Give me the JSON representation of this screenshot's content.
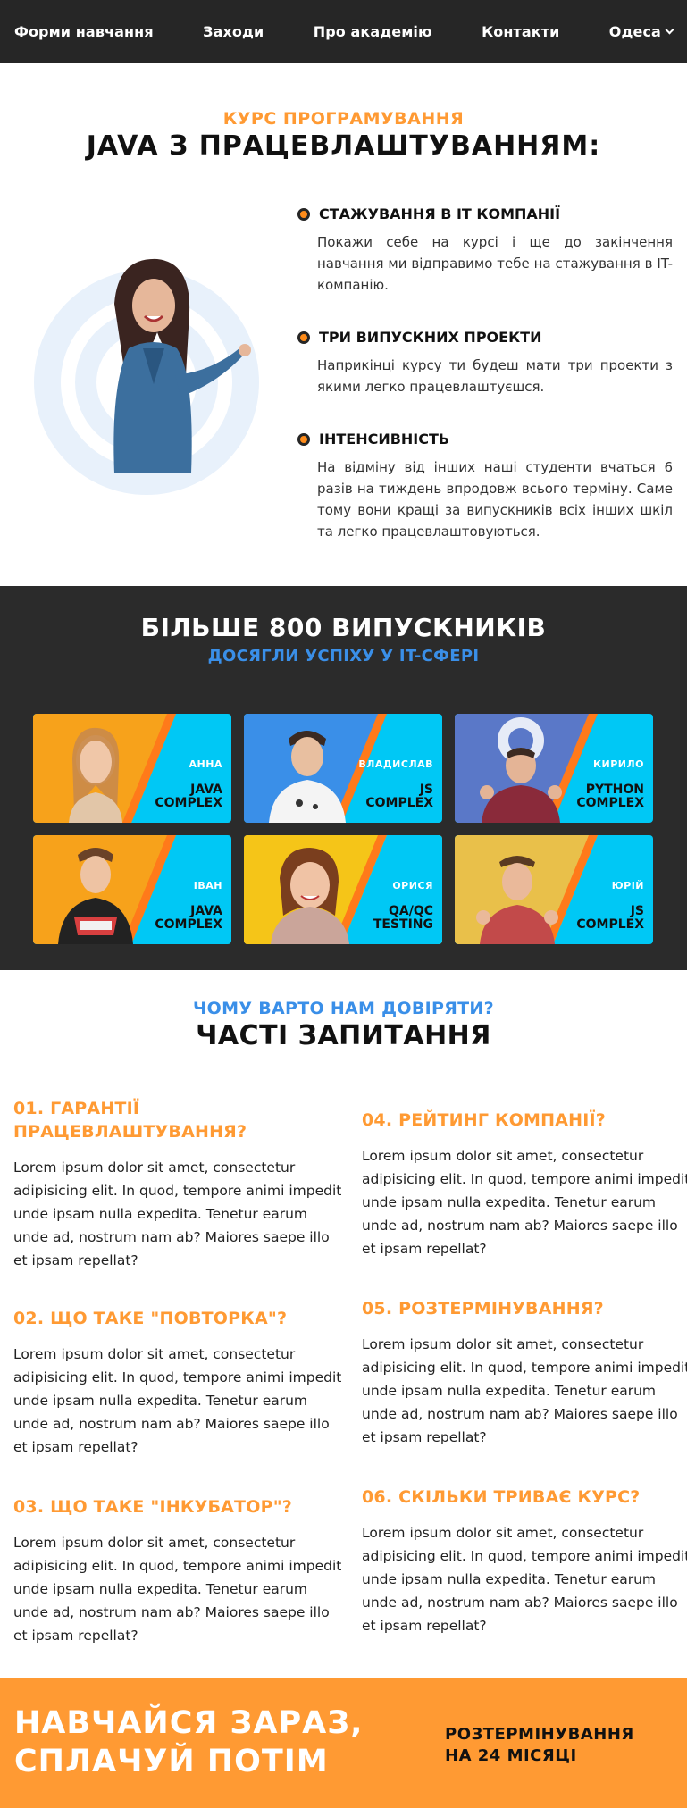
{
  "nav": {
    "items": [
      "Форми навчання",
      "Заходи",
      "Про академію",
      "Контакти"
    ],
    "city": "Одеса"
  },
  "hero": {
    "subtitle": "КУРС ПРОГРАМУВАННЯ",
    "title": "JAVA З ПРАЦЕВЛАШТУВАННЯМ:",
    "features": [
      {
        "title": "СТАЖУВАННЯ В IT КОМПАНІЇ",
        "text": "Покажи себе на курсі і ще до закінчення навчання ми відправимо тебе на стажування в IT-компанію."
      },
      {
        "title": "ТРИ ВИПУСКНИХ ПРОЕКТИ",
        "text": "Наприкінці курсу ти будеш мати три проекти з якими легко працевлаштуєшся."
      },
      {
        "title": "ІНТЕНСИВНІСТЬ",
        "text": "На відміну від інших наші студенти вчаться 6 разів на тиждень впродовж всього терміну. Саме тому вони кращі за випускників всіх інших шкіл та легко працевлаштовуються."
      }
    ]
  },
  "graduates": {
    "title": "БІЛЬШЕ 800 ВИПУСКНИКІВ",
    "subtitle": "ДОСЯГЛИ УСПІХУ У IT-СФЕРІ",
    "cards": [
      {
        "name": "АННА",
        "course_line1": "JAVA",
        "course_line2": "COMPLEX"
      },
      {
        "name": "ВЛАДИСЛАВ",
        "course_line1": "JS",
        "course_line2": "COMPLEX"
      },
      {
        "name": "КИРИЛО",
        "course_line1": "PYTHON",
        "course_line2": "COMPLEX"
      },
      {
        "name": "ІВАН",
        "course_line1": "JAVA",
        "course_line2": "COMPLEX"
      },
      {
        "name": "ОРИСЯ",
        "course_line1": "QA/QC",
        "course_line2": "TESTING"
      },
      {
        "name": "ЮРІЙ",
        "course_line1": "JS",
        "course_line2": "COMPLEX"
      }
    ]
  },
  "faq": {
    "subtitle": "ЧОМУ ВАРТО НАМ ДОВІРЯТИ?",
    "title": "ЧАСТІ ЗАПИТАННЯ",
    "items": [
      {
        "q": "01. ГАРАНТІЇ ПРАЦЕВЛАШТУВАННЯ?",
        "a": "Lorem ipsum dolor sit amet, consectetur adipisicing elit. In quod, tempore animi impedit unde ipsam nulla expedita. Tenetur earum unde ad, nostrum nam ab? Maiores saepe illo et ipsam repellat?"
      },
      {
        "q": "02. ЩО ТАКЕ \"ПОВТОРКА\"?",
        "a": "Lorem ipsum dolor sit amet, consectetur adipisicing elit. In quod, tempore animi impedit unde ipsam nulla expedita. Tenetur earum unde ad, nostrum nam ab? Maiores saepe illo et ipsam repellat?"
      },
      {
        "q": "03. ЩО ТАКЕ \"ІНКУБАТОР\"?",
        "a": "Lorem ipsum dolor sit amet, consectetur adipisicing elit. In quod, tempore animi impedit unde ipsam nulla expedita. Tenetur earum unde ad, nostrum nam ab? Maiores saepe illo et ipsam repellat?"
      },
      {
        "q": "04. РЕЙТИНГ КОМПАНІЇ?",
        "a": "Lorem ipsum dolor sit amet, consectetur adipisicing elit. In quod, tempore animi impedit unde ipsam nulla expedita. Tenetur earum unde ad, nostrum nam ab? Maiores saepe illo et ipsam repellat?"
      },
      {
        "q": "05. РОЗТЕРМІНУВАННЯ?",
        "a": "Lorem ipsum dolor sit amet, consectetur adipisicing elit. In quod, tempore animi impedit unde ipsam nulla expedita. Tenetur earum unde ad, nostrum nam ab? Maiores saepe illo et ipsam repellat?"
      },
      {
        "q": "06. СКІЛЬКИ ТРИВАЄ КУРС?",
        "a": "Lorem ipsum dolor sit amet, consectetur adipisicing elit. In quod, tempore animi impedit unde ipsam nulla expedita. Tenetur earum unde ad, nostrum nam ab? Maiores saepe illo et ipsam repellat?"
      }
    ]
  },
  "cta": {
    "left_line1": "НАВЧАЙСЯ ЗАРАЗ,",
    "left_line2": "СПЛАЧУЙ ПОТІМ",
    "right_line1": "РОЗТЕРМІНУВАННЯ",
    "right_line2": "НА 24 МІСЯЦІ"
  },
  "colors": {
    "accent_orange": "#ff9a33",
    "accent_blue": "#3a8fe8",
    "dark": "#262626",
    "card_cyan": "#00c8f5"
  }
}
